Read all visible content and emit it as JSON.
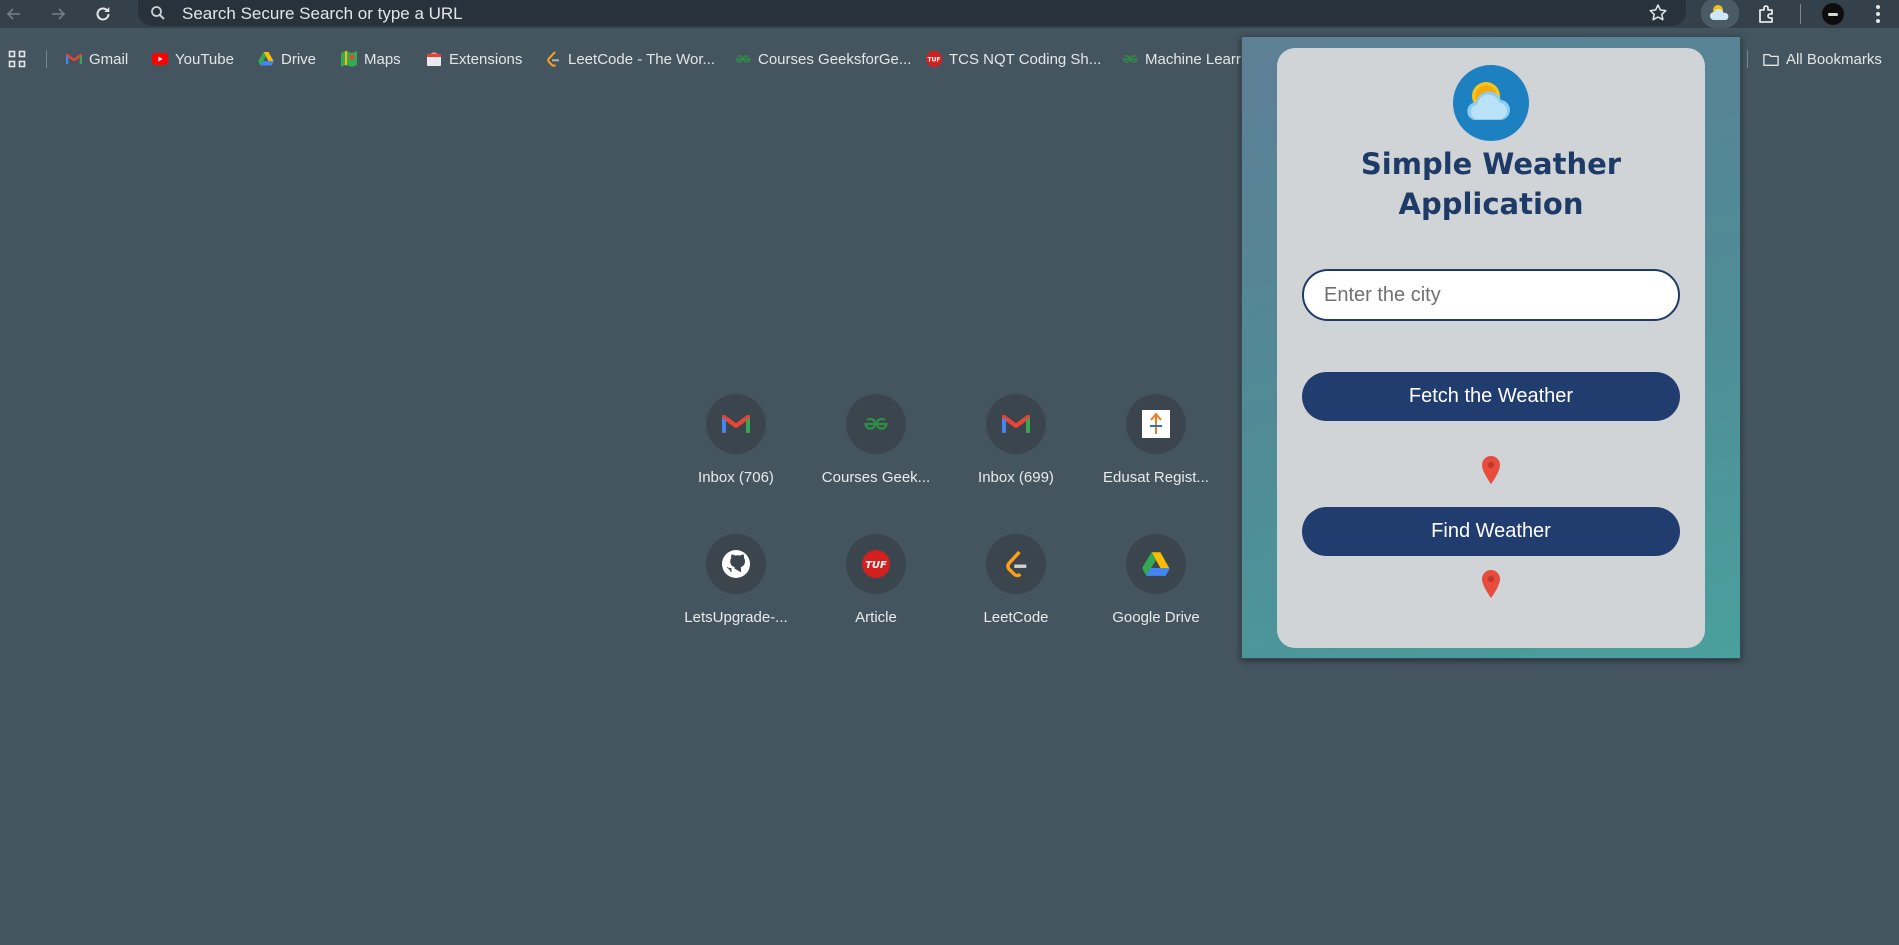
{
  "toolbar": {
    "omnibox_text": "Search Secure Search or type a URL"
  },
  "bookmarks": {
    "items": [
      {
        "label": "Gmail",
        "icon": "gmail-icon"
      },
      {
        "label": "YouTube",
        "icon": "youtube-icon"
      },
      {
        "label": "Drive",
        "icon": "drive-icon"
      },
      {
        "label": "Maps",
        "icon": "maps-icon"
      },
      {
        "label": "Extensions",
        "icon": "extensions-icon"
      },
      {
        "label": "LeetCode - The Wor...",
        "icon": "leetcode-icon"
      },
      {
        "label": "Courses GeeksforGe...",
        "icon": "geeksforgeeks-icon"
      },
      {
        "label": "TCS NQT Coding Sh...",
        "icon": "tuf-icon"
      },
      {
        "label": "Machine Learr",
        "icon": "geeksforgeeks-icon"
      }
    ],
    "all_bookmarks": "All Bookmarks"
  },
  "shortcuts": [
    {
      "label": "Inbox (706)",
      "icon": "gmail-icon"
    },
    {
      "label": "Courses Geek...",
      "icon": "geeksforgeeks-icon"
    },
    {
      "label": "Inbox (699)",
      "icon": "gmail-icon"
    },
    {
      "label": "Edusat Regist...",
      "icon": "edusat-icon"
    },
    {
      "label": "LetsUpgrade-...",
      "icon": "github-icon"
    },
    {
      "label": "Article",
      "icon": "tuf-icon"
    },
    {
      "label": "LeetCode",
      "icon": "leetcode-icon"
    },
    {
      "label": "Google Drive",
      "icon": "drive-icon"
    }
  ],
  "popup": {
    "title_line1": "Simple Weather",
    "title_line2": "Application",
    "city_placeholder": "Enter the city",
    "fetch_button": "Fetch the Weather",
    "find_button": "Find Weather"
  },
  "colors": {
    "page_bg": "#45555f",
    "toolbar_bg": "#35414a",
    "card_bg": "#d1d4d7",
    "title": "#1e3a66",
    "button_bg": "#213d6f",
    "pin": "#e74c3c"
  }
}
